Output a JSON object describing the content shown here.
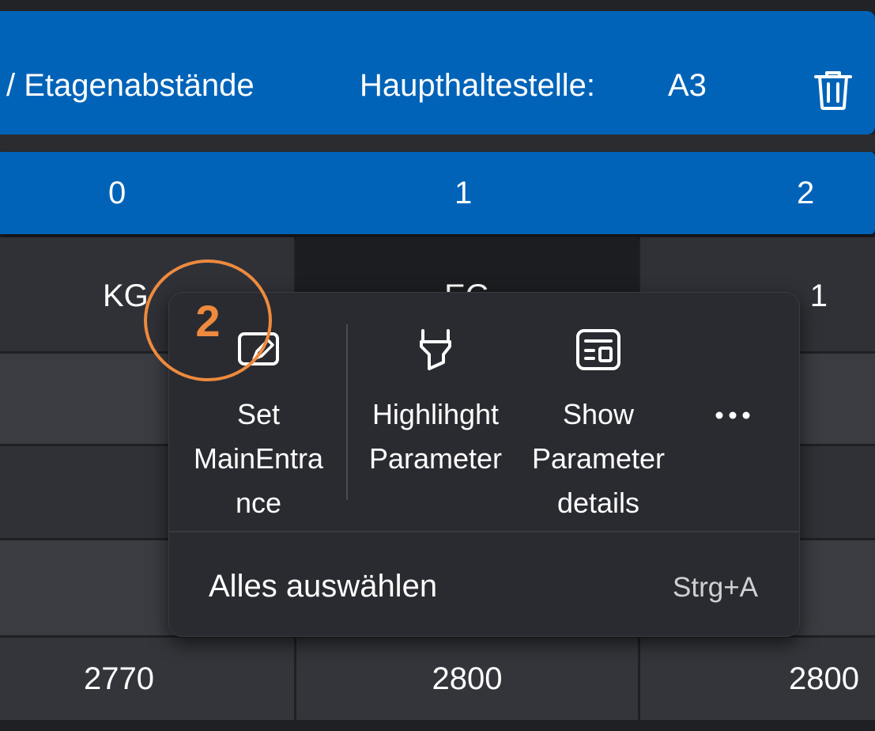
{
  "header": {
    "title": "/ Etagenabstände",
    "main_stop_label": "Haupthaltestelle:",
    "main_stop_value": "A3",
    "delete_icon": "trash-icon"
  },
  "columns": [
    "0",
    "1",
    "2"
  ],
  "table": {
    "row0": [
      "KG",
      "EG",
      "1"
    ],
    "row_bottom": [
      "2770",
      "2800",
      "2800"
    ]
  },
  "context_menu": {
    "items": [
      {
        "label": "Set\nMainEntra\nnce",
        "icon": "set-main-entrance-icon"
      },
      {
        "label": "Highlihght\nParameter",
        "icon": "highlight-icon"
      },
      {
        "label": "Show\nParameter\ndetails",
        "icon": "details-icon"
      }
    ],
    "more_icon": "more-icon",
    "select_all_label": "Alles auswählen",
    "select_all_shortcut": "Strg+A"
  },
  "annotation": {
    "step": "2",
    "color": "#ee8a3e"
  },
  "colors": {
    "accent": "#0063b8",
    "background": "#1f2024",
    "menu": "#2a2b30"
  }
}
